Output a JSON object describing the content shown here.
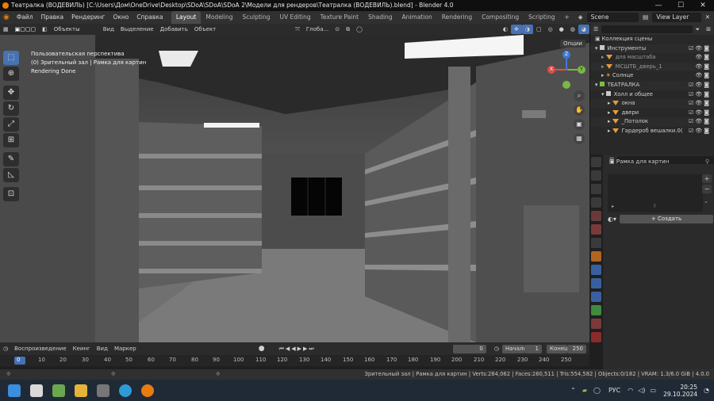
{
  "window": {
    "title": "Театралка (ВОДЕВИЛЬ) [C:\\Users\\Дом\\OneDrive\\Desktop\\SDoA\\SDoA\\SDoA 2\\Модели для рендеров\\Театралка (ВОДЕВИЛЬ).blend] - Blender 4.0",
    "minimize": "—",
    "maximize": "☐",
    "close": "✕"
  },
  "menubar": {
    "menus": [
      "Файл",
      "Правка",
      "Рендеринг",
      "Окно",
      "Справка"
    ],
    "workspaces": [
      "Layout",
      "Modeling",
      "Sculpting",
      "UV Editing",
      "Texture Paint",
      "Shading",
      "Animation",
      "Rendering",
      "Compositing",
      "Scripting"
    ],
    "add_tab": "+",
    "scene": "Scene",
    "view_layer": "View Layer"
  },
  "viewport_header": {
    "mode": "Объекты",
    "menus": [
      "Вид",
      "Выделение",
      "Добавить",
      "Объект"
    ],
    "transform": "Глоба...",
    "options": "Опции"
  },
  "viewport": {
    "overlay_lines": [
      "Пользовательская перспектива",
      "(0) Зрительный зал | Рамка для картин",
      "Rendering Done"
    ],
    "gizmo": {
      "x": "X",
      "y": "Y",
      "z": "Z"
    }
  },
  "toolbar": {
    "tools": [
      "select-box",
      "cursor",
      "move",
      "rotate",
      "scale",
      "transform",
      "annotate",
      "measure",
      "add-cube"
    ]
  },
  "timeline": {
    "menus": [
      "Воспроизведение",
      "Кеинг",
      "Вид",
      "Маркер"
    ],
    "current_frame": "0",
    "start_label": "Начало",
    "start": "1",
    "end_label": "Конец",
    "end": "250",
    "ticks": [
      "0",
      "10",
      "20",
      "30",
      "40",
      "50",
      "60",
      "70",
      "80",
      "90",
      "100",
      "110",
      "120",
      "130",
      "140",
      "150",
      "160",
      "170",
      "180",
      "190",
      "200",
      "210",
      "220",
      "230",
      "240",
      "250"
    ]
  },
  "statusbar": {
    "text": "Зрительный зал | Рамка для картин | Verts:284,062 | Faces:260,511 | Tris:554,582 | Objects:0/182 | VRAM: 1.3/6.0 GiB | 4.0.0"
  },
  "outliner": {
    "header": "Коллекция сцены",
    "rows": [
      {
        "label": "Инструменты",
        "type": "collection"
      },
      {
        "label": "для масштаба",
        "type": "object"
      },
      {
        "label": "МСШТБ_дверь_1",
        "type": "object"
      },
      {
        "label": "Солнце",
        "type": "light"
      },
      {
        "label": "ТЕАТРАЛКА",
        "type": "collection"
      },
      {
        "label": "Холл и общее",
        "type": "collection"
      },
      {
        "label": "окна",
        "type": "object"
      },
      {
        "label": "двери",
        "type": "object"
      },
      {
        "label": "_Потолок",
        "type": "object"
      },
      {
        "label": "Гардероб вешалки.0(",
        "type": "object"
      }
    ]
  },
  "properties": {
    "object_name": "Рамка для картин",
    "create_button": "Создать",
    "add": "+",
    "remove": "−"
  },
  "taskbar": {
    "language": "РУС",
    "time": "20:25",
    "date": "29.10.2024"
  }
}
